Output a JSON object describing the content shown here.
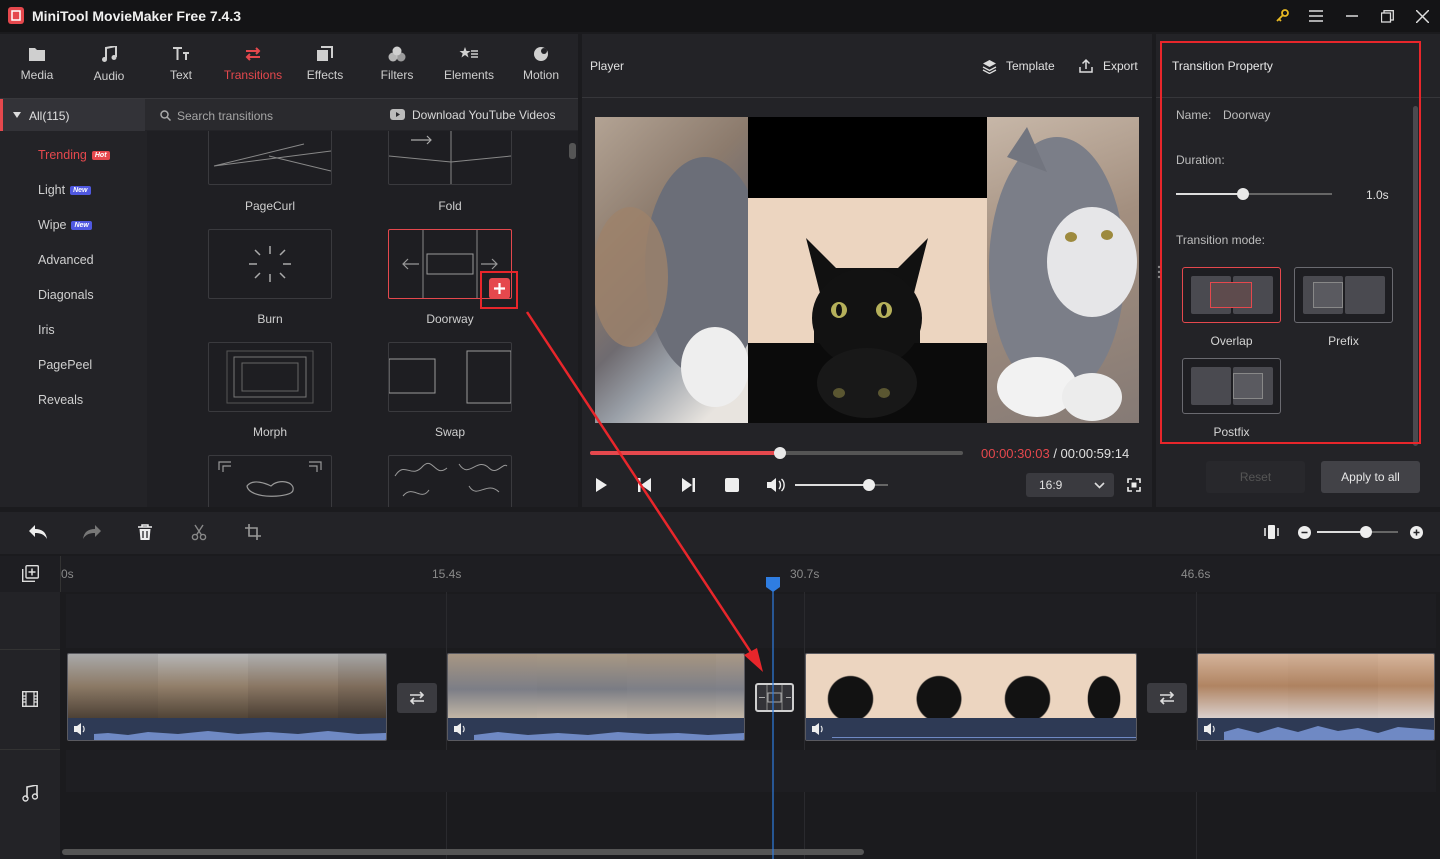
{
  "app": {
    "title": "MiniTool MovieMaker Free 7.4.3"
  },
  "nav": {
    "tabs": [
      {
        "label": "Media",
        "icon": "folder-icon"
      },
      {
        "label": "Audio",
        "icon": "music-note-icon"
      },
      {
        "label": "Text",
        "icon": "text-icon"
      },
      {
        "label": "Transitions",
        "icon": "transition-icon"
      },
      {
        "label": "Effects",
        "icon": "effects-icon"
      },
      {
        "label": "Filters",
        "icon": "filters-icon"
      },
      {
        "label": "Elements",
        "icon": "elements-icon"
      },
      {
        "label": "Motion",
        "icon": "motion-icon"
      }
    ],
    "active": "Transitions"
  },
  "categories": {
    "all_label": "All(115)",
    "search_placeholder": "Search transitions",
    "download_label": "Download YouTube Videos",
    "items": [
      {
        "label": "Trending",
        "badge": "Hot"
      },
      {
        "label": "Light",
        "badge": "New"
      },
      {
        "label": "Wipe",
        "badge": "New"
      },
      {
        "label": "Advanced",
        "badge": ""
      },
      {
        "label": "Diagonals",
        "badge": ""
      },
      {
        "label": "Iris",
        "badge": ""
      },
      {
        "label": "PagePeel",
        "badge": ""
      },
      {
        "label": "Reveals",
        "badge": ""
      }
    ]
  },
  "transitions": {
    "items": [
      "PageCurl",
      "Fold",
      "Burn",
      "Doorway",
      "Morph",
      "Swap"
    ]
  },
  "player": {
    "title": "Player",
    "template_label": "Template",
    "export_label": "Export",
    "current_time": "00:00:30:03",
    "total_time": "/ 00:00:59:14",
    "progress": 0.51,
    "volume": 0.8,
    "aspect_ratio": "16:9"
  },
  "property": {
    "title": "Transition Property",
    "name_label": "Name:",
    "name_value": "Doorway",
    "duration_label": "Duration:",
    "duration_value": "1.0s",
    "duration_fraction": 0.43,
    "mode_label": "Transition mode:",
    "modes": [
      "Overlap",
      "Prefix",
      "Postfix"
    ],
    "selected_mode": "Overlap",
    "reset_label": "Reset",
    "apply_label": "Apply to all"
  },
  "timeline": {
    "ticks": [
      "0s",
      "15.4s",
      "30.7s",
      "46.6s"
    ],
    "zoom_level": 0.6
  },
  "colors": {
    "accent": "#e5484d",
    "playhead": "#2f7de1",
    "annotation": "#e8262b"
  }
}
